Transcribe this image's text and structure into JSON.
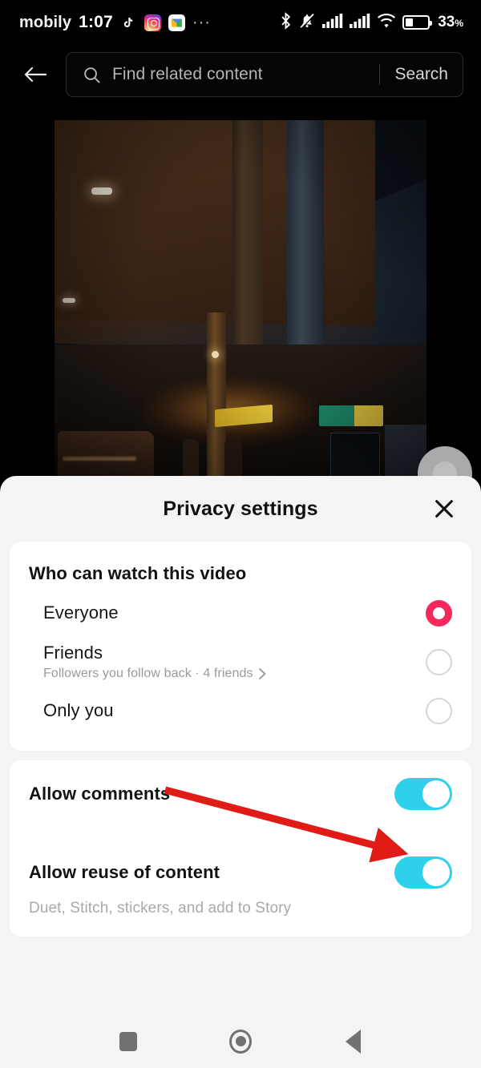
{
  "status_bar": {
    "carrier": "mobily",
    "time": "1:07",
    "app_icons": [
      "tiktok-icon",
      "instagram-icon",
      "gmail-icon"
    ],
    "overflow": "···",
    "right_icons": [
      "bluetooth-icon",
      "silent-mode-icon",
      "signal-1-icon",
      "signal-2-icon",
      "wifi-icon",
      "battery-icon"
    ],
    "battery_percent": "33",
    "battery_unit": "%"
  },
  "header": {
    "back_icon": "back-arrow-icon",
    "search_icon": "search-icon",
    "search_placeholder": "Find related content",
    "search_value": "",
    "search_button": "Search"
  },
  "video": {
    "description": "gas station at night",
    "avatar": "profile-avatar"
  },
  "sheet": {
    "title": "Privacy settings",
    "close_icon": "close-icon",
    "privacy_card": {
      "title": "Who can watch this video",
      "options": [
        {
          "label": "Everyone",
          "sub": "",
          "selected": true,
          "has_chevron": false
        },
        {
          "label": "Friends",
          "sub": "Followers you follow back · 4 friends",
          "selected": false,
          "has_chevron": true
        },
        {
          "label": "Only you",
          "sub": "",
          "selected": false,
          "has_chevron": false
        }
      ]
    },
    "toggles_card": {
      "items": [
        {
          "label": "Allow comments",
          "sub": "",
          "on": true
        },
        {
          "label": "Allow reuse of content",
          "sub": "Duet, Stitch, stickers, and add to Story",
          "on": true
        }
      ]
    }
  },
  "annotation": {
    "arrow": "red-arrow-pointing-to-allow-comments-toggle",
    "color": "#e11b16"
  },
  "navbar": {
    "buttons": [
      "recents-button",
      "home-button",
      "back-button"
    ]
  },
  "colors": {
    "accent_radio": "#f4285a",
    "toggle_on": "#2ed1ec",
    "sheet_bg": "#f4f4f4",
    "card_bg": "#ffffff",
    "annotation_red": "#e11b16"
  }
}
